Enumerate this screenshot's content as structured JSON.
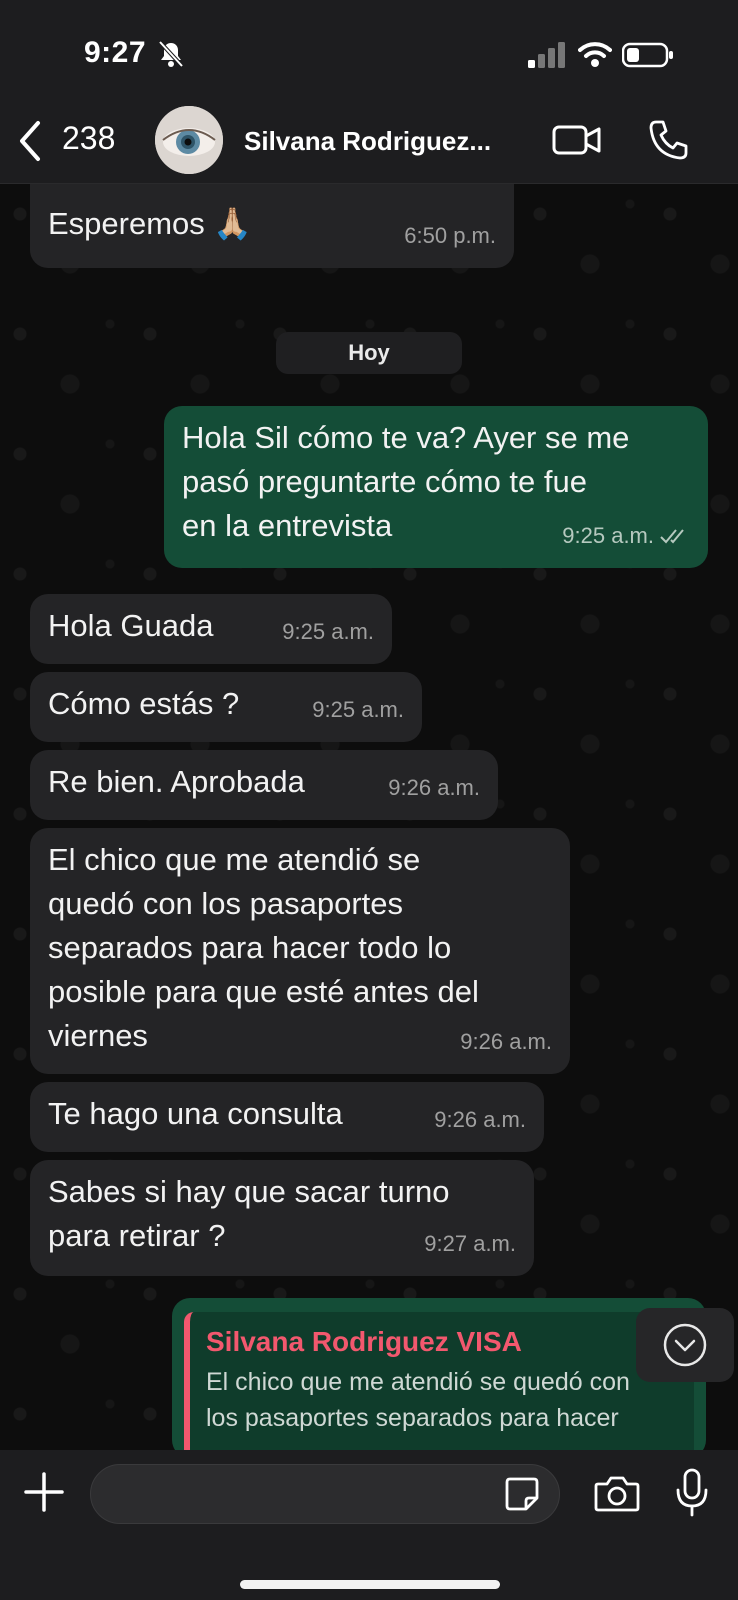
{
  "status_bar": {
    "time": "9:27"
  },
  "header": {
    "back_count": "238",
    "contact_name": "Silvana Rodriguez...",
    "avatar_icon": "eye-avatar"
  },
  "date_divider": "Hoy",
  "messages": [
    {
      "dir": "in",
      "text": "Esperemos 🙏🏼",
      "time": "6:50 p.m."
    },
    {
      "dir": "out",
      "text": "Hola Sil cómo te va? Ayer se me\npasó preguntarte cómo te fue\nen la entrevista",
      "time": "9:25 a.m.",
      "read": true
    },
    {
      "dir": "in",
      "text": "Hola Guada",
      "time": "9:25 a.m."
    },
    {
      "dir": "in",
      "text": "Cómo estás ?",
      "time": "9:25 a.m."
    },
    {
      "dir": "in",
      "text": "Re bien. Aprobada",
      "time": "9:26 a.m."
    },
    {
      "dir": "in",
      "text": "El chico que me atendió se\nquedó con los pasaportes\nseparados para hacer todo lo\nposible para que esté antes del\nviernes",
      "time": "9:26 a.m."
    },
    {
      "dir": "in",
      "text": "Te hago una consulta",
      "time": "9:26 a.m."
    },
    {
      "dir": "in",
      "text": "Sabes si hay que sacar turno\npara retirar ?",
      "time": "9:27 a.m."
    }
  ],
  "reply_preview": {
    "author": "Silvana Rodriguez VISA",
    "snippet": "El chico que me atendió se quedó con\nlos pasaportes separados para hacer"
  },
  "input": {
    "placeholder": ""
  },
  "colors": {
    "outgoing_bubble": "#144d37",
    "incoming_bubble": "#242426",
    "reply_accent": "#f2586e"
  }
}
